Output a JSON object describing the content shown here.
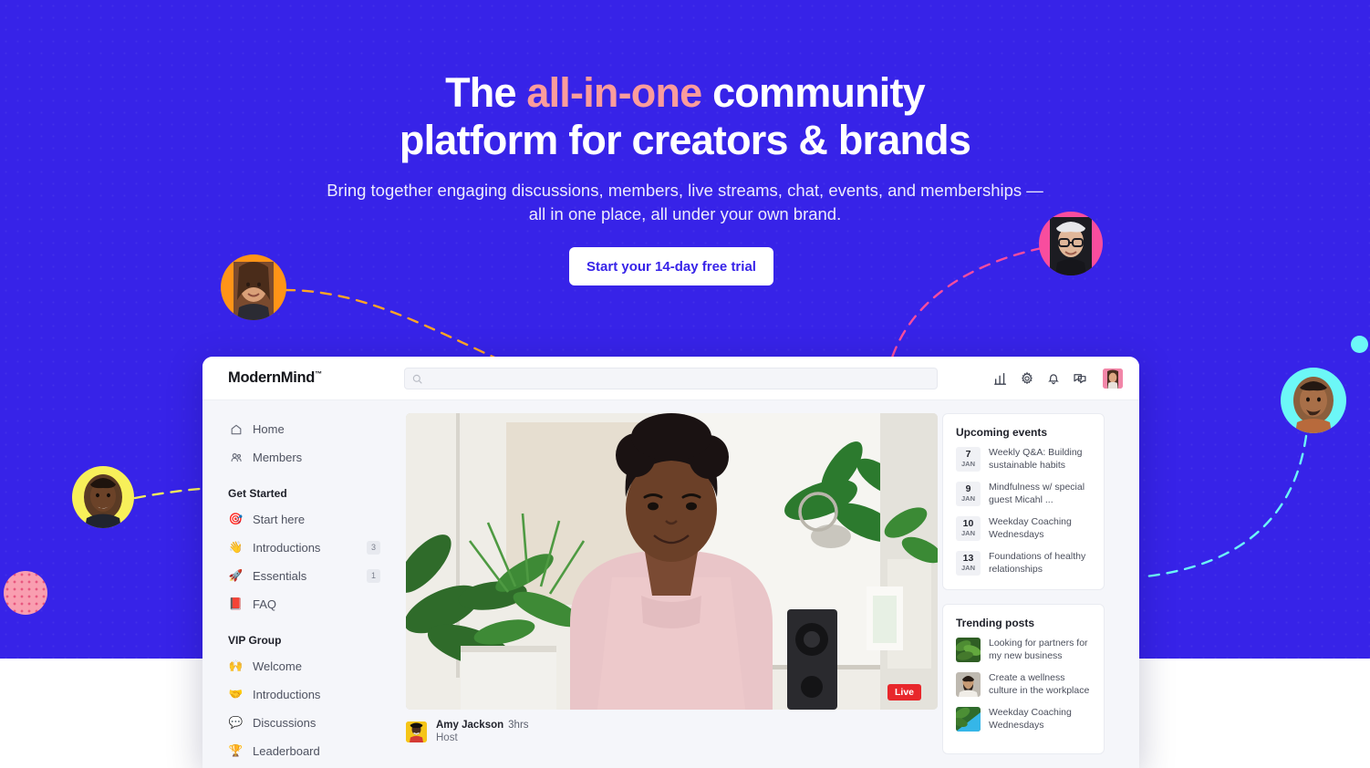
{
  "hero": {
    "headline_1a": "The ",
    "headline_accent": "all-in-one",
    "headline_1b": " community",
    "headline_2": "platform for creators &  brands",
    "subhead": "Bring together engaging discussions, members, live streams, chat, events, and memberships — all in one place, all under your own brand.",
    "cta_label": "Start your 14-day free trial",
    "background_color": "#3723E8",
    "accent_color": "#FB9C9C"
  },
  "decorations": {
    "avatars": [
      {
        "name": "avatar-orange",
        "ring_color": "#FF9417"
      },
      {
        "name": "avatar-pink",
        "ring_color": "#F84D9E"
      },
      {
        "name": "avatar-cyan",
        "ring_color": "#6CF7F7"
      },
      {
        "name": "avatar-yellow",
        "ring_color": "#F7F05A"
      }
    ],
    "dot_cyan_color": "#6CF7F7",
    "dot_pink_color": "#F99EB0",
    "connector_colors": [
      "#FFA526",
      "#F84D9E",
      "#F7F05A",
      "#6CF7F7"
    ]
  },
  "app": {
    "logo": "ModernMind",
    "logo_tm": "™",
    "search": {
      "value": "",
      "placeholder": "",
      "icon": "search-icon"
    },
    "header_icons": [
      "analytics-icon",
      "gear-icon",
      "bell-icon",
      "chat-icon"
    ],
    "avatar": "user-avatar",
    "sidebar": {
      "top_items": [
        {
          "icon": "home-icon",
          "label": "Home",
          "badge": ""
        },
        {
          "icon": "members-icon",
          "label": "Members",
          "badge": ""
        }
      ],
      "groups": [
        {
          "title": "Get Started",
          "items": [
            {
              "emoji": "🎯",
              "icon": "dart-icon",
              "label": "Start here",
              "badge": ""
            },
            {
              "emoji": "👋",
              "icon": "waving-hand-icon",
              "label": "Introductions",
              "badge": "3"
            },
            {
              "emoji": "🚀",
              "icon": "rocket-icon",
              "label": "Essentials",
              "badge": "1"
            },
            {
              "emoji": "📕",
              "icon": "closed-book-icon",
              "label": "FAQ",
              "badge": ""
            }
          ]
        },
        {
          "title": "VIP Group",
          "items": [
            {
              "emoji": "🙌",
              "icon": "raising-hands-icon",
              "label": "Welcome",
              "badge": ""
            },
            {
              "emoji": "🤝",
              "icon": "handshake-icon",
              "label": "Introductions",
              "badge": ""
            },
            {
              "emoji": "💬",
              "icon": "speech-balloon-icon",
              "label": "Discussions",
              "badge": ""
            },
            {
              "emoji": "🏆",
              "icon": "trophy-icon",
              "label": "Leaderboard",
              "badge": ""
            }
          ]
        }
      ]
    },
    "feed": {
      "live_badge": "Live",
      "post_author": "Amy Jackson",
      "post_time": "3hrs",
      "post_role": "Host"
    },
    "rail": {
      "events_title": "Upcoming events",
      "events": [
        {
          "day": "7",
          "month": "JAN",
          "title": "Weekly Q&A: Building sustainable habits"
        },
        {
          "day": "9",
          "month": "JAN",
          "title": "Mindfulness w/ special guest Micahl ..."
        },
        {
          "day": "10",
          "month": "JAN",
          "title": "Weekday Coaching Wednesdays"
        },
        {
          "day": "13",
          "month": "JAN",
          "title": "Foundations of healthy relationships"
        }
      ],
      "trending_title": "Trending posts",
      "trending": [
        {
          "title": "Looking for partners for my new business",
          "thumb": "#3E6B2C"
        },
        {
          "title": "Create a wellness culture in the workplace",
          "thumb": "#4A4139"
        },
        {
          "title": "Weekday Coaching Wednesdays",
          "thumb": "#2D9FD4"
        }
      ]
    }
  }
}
